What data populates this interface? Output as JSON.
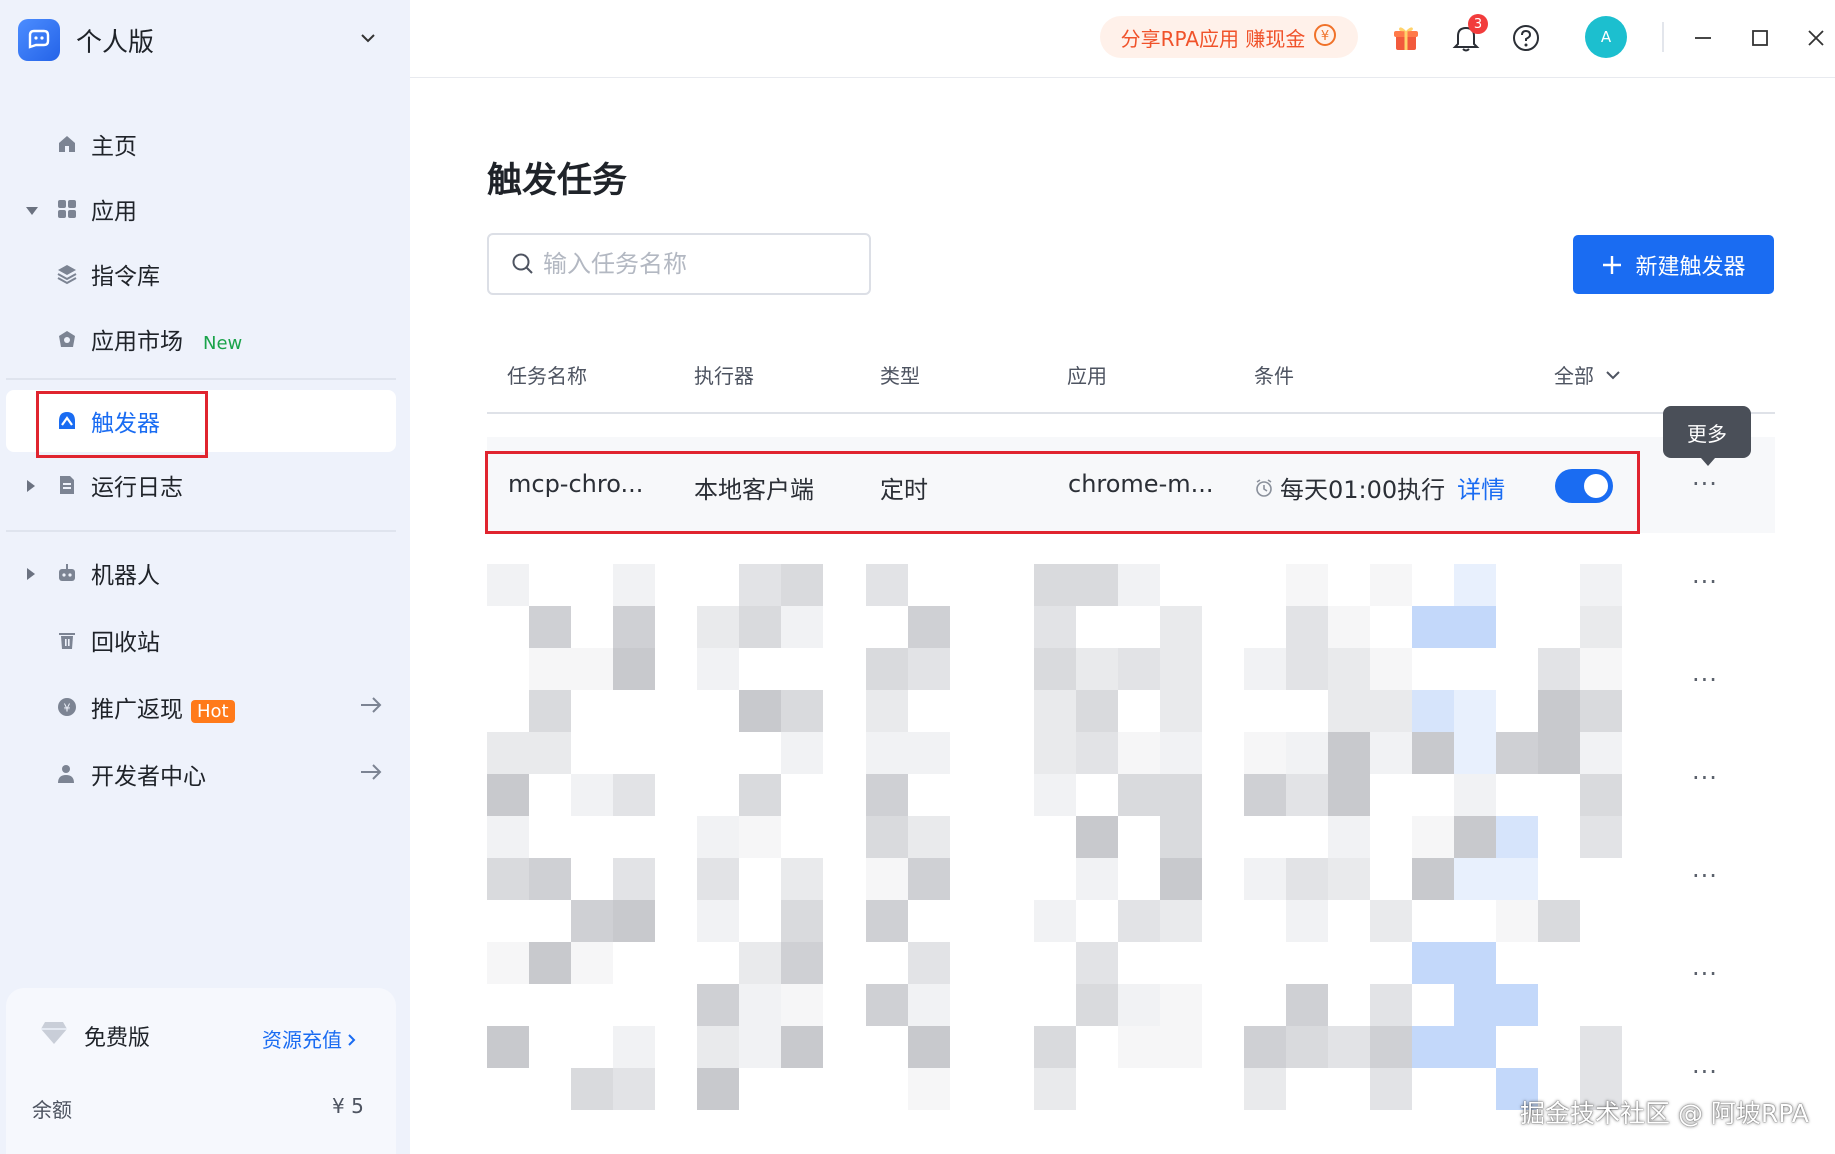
{
  "sidebar": {
    "workspace": "个人版",
    "items": [
      {
        "label": "主页"
      },
      {
        "label": "应用"
      },
      {
        "label": "指令库"
      },
      {
        "label": "应用市场",
        "badge": "New"
      },
      {
        "label": "触发器"
      },
      {
        "label": "运行日志"
      },
      {
        "label": "机器人"
      },
      {
        "label": "回收站"
      },
      {
        "label": "推广返现",
        "badge": "Hot"
      },
      {
        "label": "开发者中心"
      }
    ],
    "plan": {
      "name": "免费版",
      "recharge": "资源充值",
      "balance_label": "余额",
      "balance_value": "¥ 5"
    }
  },
  "topbar": {
    "promo": "分享RPA应用 赚现金",
    "notification_count": "3",
    "avatar_initial": "A"
  },
  "main": {
    "title": "触发任务",
    "search_placeholder": "输入任务名称",
    "new_button": "新建触发器",
    "columns": [
      "任务名称",
      "执行器",
      "类型",
      "应用",
      "条件"
    ],
    "filter_label": "全部",
    "rows": [
      {
        "name": "mcp-chro...",
        "executor": "本地客户端",
        "type": "定时",
        "app": "chrome-m...",
        "condition": "每天01:00执行",
        "detail": "详情",
        "enabled": true
      }
    ],
    "tooltip": "更多",
    "more_glyph": "···"
  },
  "watermark": "掘金技术社区 @ 阿坡RPA",
  "colors": {
    "accent": "#1a6cf2",
    "highlight_box": "#e0242f",
    "sidebar_bg": "#eef2fb"
  }
}
